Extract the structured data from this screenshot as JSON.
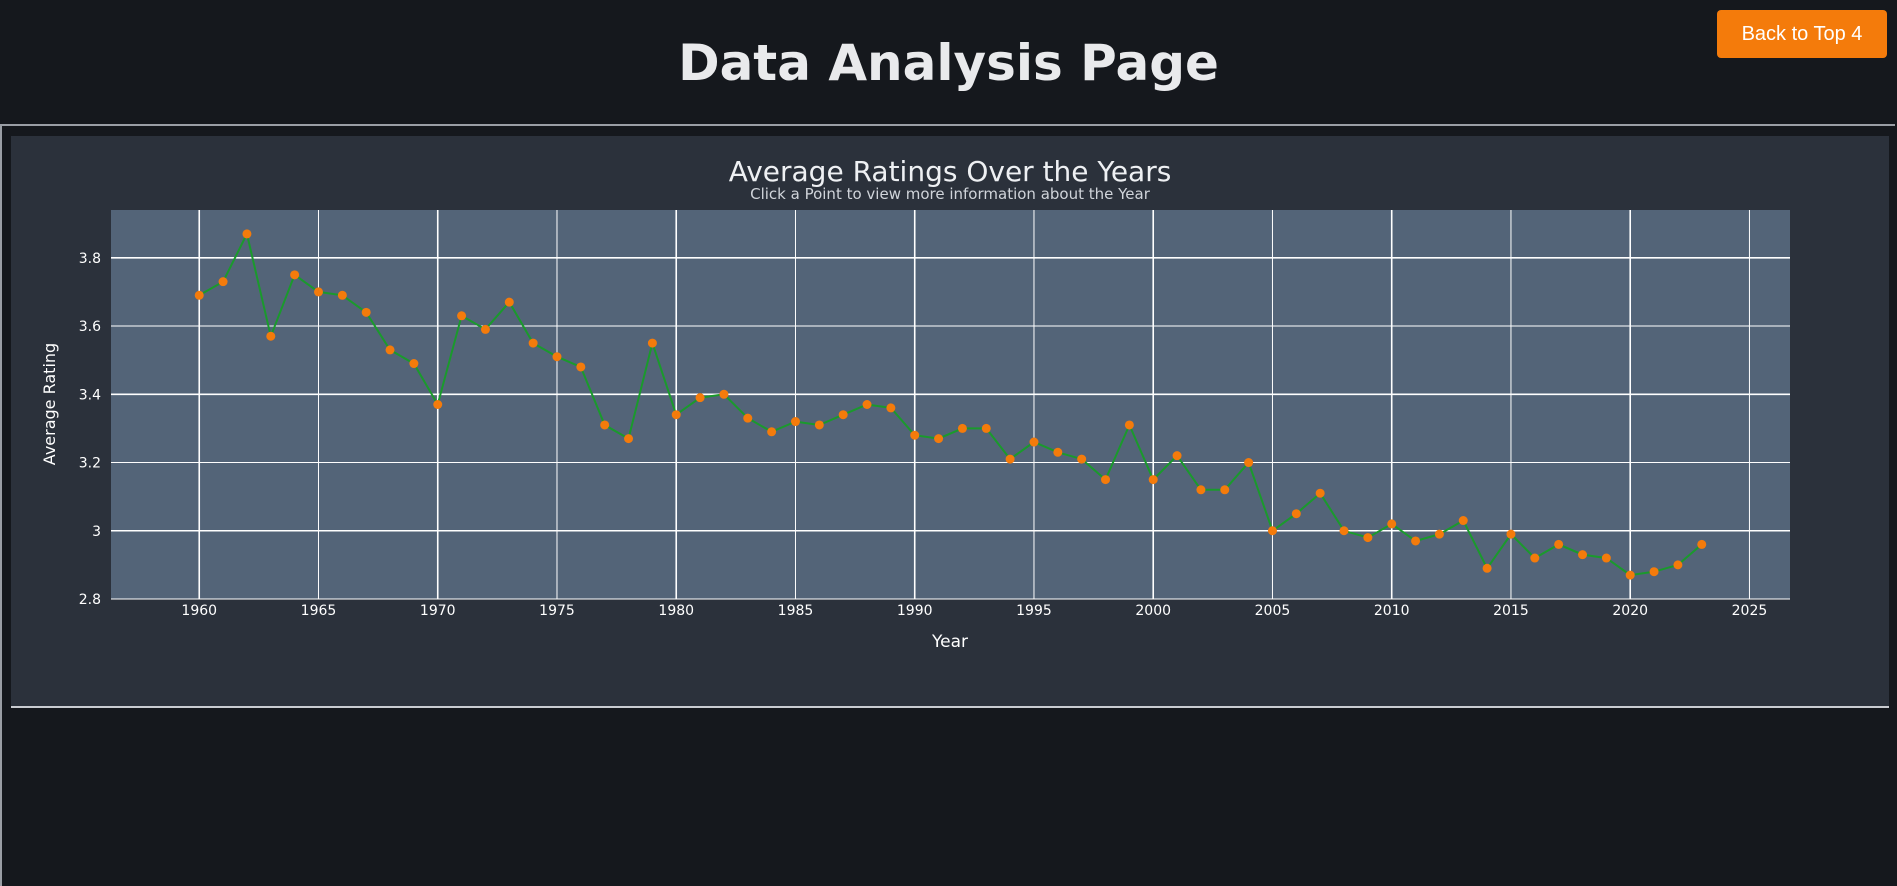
{
  "header": {
    "title": "Data Analysis Page",
    "back_button_label": "Back to Top 4"
  },
  "colors": {
    "page_bg": "#15181d",
    "panel_bg": "#2b313b",
    "plot_bg": "#536478",
    "line": "#1a9a2c",
    "marker": "#f47b0b",
    "button": "#f47b0b"
  },
  "chart_data": {
    "type": "line",
    "title": "Average Ratings Over the Years",
    "subtitle": "Click a Point to view more information about the Year",
    "xlabel": "Year",
    "ylabel": "Average Rating",
    "xlim": [
      1956.3,
      2026.7
    ],
    "ylim": [
      2.8,
      3.94
    ],
    "x_ticks": [
      1960,
      1965,
      1970,
      1975,
      1980,
      1985,
      1990,
      1995,
      2000,
      2005,
      2010,
      2015,
      2020,
      2025
    ],
    "y_ticks": [
      2.8,
      3,
      3.2,
      3.4,
      3.6,
      3.8
    ],
    "y_tick_labels": [
      "2.8",
      "3",
      "3.2",
      "3.4",
      "3.6",
      "3.8"
    ],
    "grid": true,
    "series": [
      {
        "x": [
          1960,
          1961,
          1962,
          1963,
          1964,
          1965,
          1966,
          1967,
          1968,
          1969,
          1970,
          1971,
          1972,
          1973,
          1974,
          1975,
          1976,
          1977,
          1978,
          1979,
          1980,
          1981,
          1982,
          1983,
          1984,
          1985,
          1986,
          1987,
          1988,
          1989,
          1990,
          1991,
          1992,
          1993,
          1994,
          1995,
          1996,
          1997,
          1998,
          1999,
          2000,
          2001,
          2002,
          2003,
          2004,
          2005,
          2006,
          2007,
          2008,
          2009,
          2010,
          2011,
          2012,
          2013,
          2014,
          2015,
          2016,
          2017,
          2018,
          2019,
          2020,
          2021,
          2022,
          2023
        ],
        "y": [
          3.69,
          3.73,
          3.87,
          3.57,
          3.75,
          3.7,
          3.69,
          3.64,
          3.53,
          3.49,
          3.37,
          3.63,
          3.59,
          3.67,
          3.55,
          3.51,
          3.48,
          3.31,
          3.27,
          3.55,
          3.34,
          3.39,
          3.4,
          3.33,
          3.29,
          3.32,
          3.31,
          3.34,
          3.37,
          3.36,
          3.28,
          3.27,
          3.3,
          3.3,
          3.21,
          3.26,
          3.23,
          3.21,
          3.15,
          3.31,
          3.15,
          3.22,
          3.12,
          3.12,
          3.2,
          3.0,
          3.05,
          3.11,
          3.0,
          2.98,
          3.02,
          2.97,
          2.99,
          3.03,
          2.89,
          2.99,
          2.92,
          2.96,
          2.93,
          2.92,
          2.87,
          2.88,
          2.9,
          2.96
        ]
      }
    ]
  }
}
